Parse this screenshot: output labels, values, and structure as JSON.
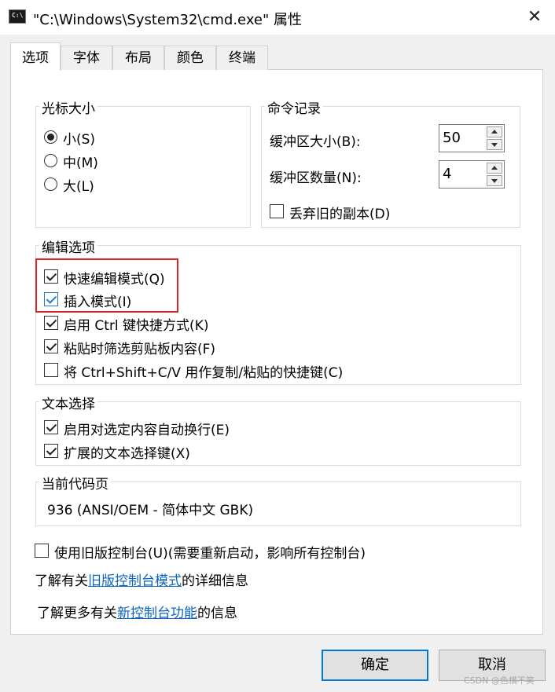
{
  "window": {
    "title": "\"C:\\Windows\\System32\\cmd.exe\" 属性",
    "close_glyph": "✕",
    "icon_text": "C:\\"
  },
  "tabs": [
    {
      "label": "选项"
    },
    {
      "label": "字体"
    },
    {
      "label": "布局"
    },
    {
      "label": "颜色"
    },
    {
      "label": "终端"
    }
  ],
  "cursor_size": {
    "legend": "光标大小",
    "options": [
      {
        "label": "小(S)"
      },
      {
        "label": "中(M)"
      },
      {
        "label": "大(L)"
      }
    ],
    "selected": "小(S)"
  },
  "command_history": {
    "legend": "命令记录",
    "buffer_size_label": "缓冲区大小(B):",
    "buffer_size_value": "50",
    "buffer_count_label": "缓冲区数量(N):",
    "buffer_count_value": "4",
    "discard_old_label": "丢弃旧的副本(D)",
    "discard_old_checked": false
  },
  "edit_options": {
    "legend": "编辑选项",
    "items": [
      {
        "label": "快速编辑模式(Q)",
        "checked": true
      },
      {
        "label": "插入模式(I)",
        "checked": true
      },
      {
        "label": "启用 Ctrl 键快捷方式(K)",
        "checked": true
      },
      {
        "label": "粘贴时筛选剪贴板内容(F)",
        "checked": true
      },
      {
        "label": "将 Ctrl+Shift+C/V 用作复制/粘贴的快捷键(C)",
        "checked": false
      }
    ]
  },
  "text_selection": {
    "legend": "文本选择",
    "items": [
      {
        "label": "启用对选定内容自动换行(E)",
        "checked": true
      },
      {
        "label": "扩展的文本选择键(X)",
        "checked": true
      }
    ]
  },
  "code_page": {
    "legend": "当前代码页",
    "value": "936   (ANSI/OEM - 简体中文 GBK)"
  },
  "legacy": {
    "label": "使用旧版控制台(U)(需要重新启动，影响所有控制台)",
    "checked": false,
    "info1_prefix": "了解有关",
    "info1_link": "旧版控制台模式",
    "info1_suffix": "的详细信息",
    "info2_prefix": "了解更多有关",
    "info2_link": "新控制台功能",
    "info2_suffix": "的信息"
  },
  "buttons": {
    "ok": "确定",
    "cancel": "取消"
  },
  "watermark": "CSDN @色横不笑",
  "colors": {
    "accent": "#0078d7",
    "link": "#0b64c0",
    "highlight": "#d6282c"
  }
}
